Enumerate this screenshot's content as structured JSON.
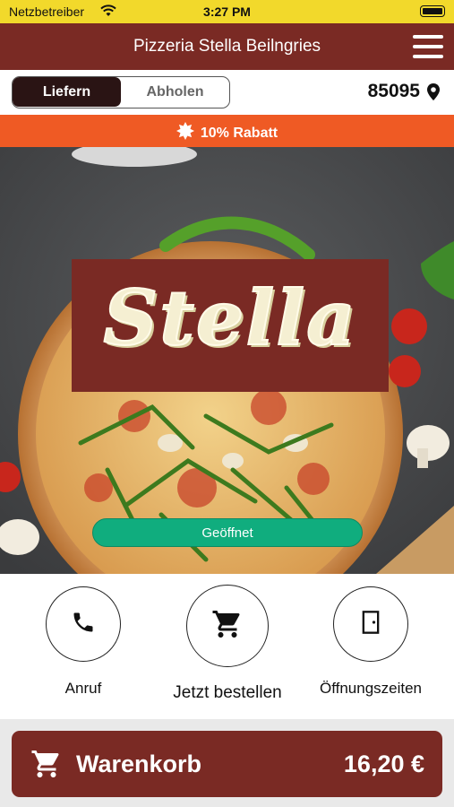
{
  "status_bar": {
    "carrier": "Netzbetreiber",
    "time": "3:27 PM",
    "icons": [
      "wifi-icon",
      "battery-icon"
    ]
  },
  "header": {
    "title": "Pizzeria Stella Beilngries",
    "menu_icon": "hamburger-menu-icon"
  },
  "order_mode": {
    "options": [
      "Liefern",
      "Abholen"
    ],
    "selected": "Liefern"
  },
  "location": {
    "zip": "85095",
    "icon": "location-pin-icon"
  },
  "promo": {
    "text": "10% Rabatt",
    "icon": "discount-badge-icon"
  },
  "hero": {
    "logo_text": "Stella",
    "status": "Geöffnet"
  },
  "actions": [
    {
      "label": "Anruf",
      "icon": "phone-icon"
    },
    {
      "label": "Jetzt bestellen",
      "icon": "cart-icon"
    },
    {
      "label": "Öffnungszeiten",
      "icon": "door-icon"
    }
  ],
  "cart": {
    "label": "Warenkorb",
    "total": "16,20 €",
    "icon": "cart-icon"
  },
  "colors": {
    "brand": "#7a2a24",
    "status_bar": "#f2d92b",
    "promo": "#ef5a24",
    "open": "#10ad7e"
  }
}
